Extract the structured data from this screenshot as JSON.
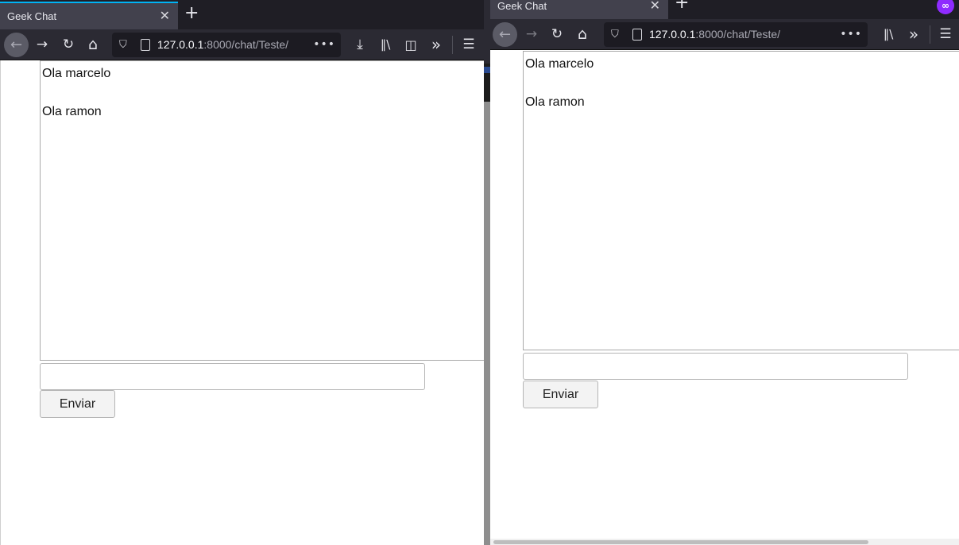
{
  "windows": [
    {
      "tab_title": "Geek Chat",
      "close_glyph": "✕",
      "newtab_glyph": "+",
      "url_host": "127.0.0.1",
      "url_rest": ":8000/chat/Teste/",
      "nav": {
        "back_glyph": "←",
        "forward_glyph": "→",
        "reload_glyph": "↻",
        "home_glyph": "⌂",
        "shield_glyph": "⛉",
        "dots_glyph": "•••",
        "download_glyph": "⤓",
        "library_glyph": "∥\\",
        "sidebar_glyph": "◫",
        "overflow_glyph": "»",
        "menu_glyph": "☰"
      },
      "messages": [
        "Ola marcelo",
        "Ola ramon"
      ],
      "input_value": "",
      "send_label": "Enviar"
    },
    {
      "tab_title": "Geek Chat",
      "close_glyph": "✕",
      "newtab_glyph": "+",
      "url_host": "127.0.0.1",
      "url_rest": ":8000/chat/Teste/",
      "nav": {
        "back_glyph": "←",
        "forward_glyph": "→",
        "reload_glyph": "↻",
        "home_glyph": "⌂",
        "shield_glyph": "⛉",
        "dots_glyph": "•••",
        "library_glyph": "∥\\",
        "overflow_glyph": "»",
        "menu_glyph": "☰"
      },
      "extension_glyph": "∞",
      "messages": [
        "Ola marcelo",
        "Ola ramon"
      ],
      "input_value": "",
      "send_label": "Enviar"
    }
  ],
  "colors": {
    "tab_accent": "#00b3f4",
    "chrome_dark": "#2b2a33",
    "extension_badge": "#8f2bff"
  }
}
